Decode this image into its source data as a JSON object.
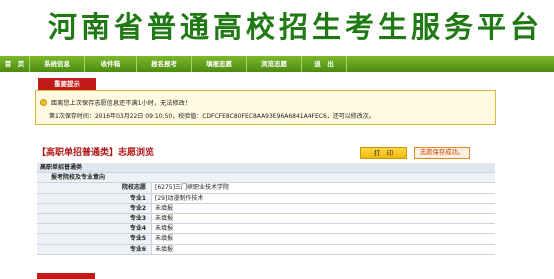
{
  "banner": {
    "title": "河南省普通高校招生考生服务平台"
  },
  "nav": {
    "items": [
      {
        "label": "首　页",
        "width": 30
      },
      {
        "label": "系统信息",
        "width": 55
      },
      {
        "label": "收件箱",
        "width": 52
      },
      {
        "label": "报名报考",
        "width": 55
      },
      {
        "label": "填报志愿",
        "width": 55
      },
      {
        "label": "浏览志愿",
        "width": 55
      },
      {
        "label": "退　出",
        "width": 45
      }
    ]
  },
  "notice": {
    "tab_label": "重要提示",
    "line1": "距离您上次保存志愿信息还不满1小时，无法修改！",
    "line2": "第1次保存时间：2016年03月22日 09:10:50，校验值：CDFCFE8C80FEC8AA93E96A6841A4FEC6，还可以修改次。"
  },
  "page_heading": "【高职单招普通类】志愿浏览",
  "print_label": "打　印",
  "saved_label": "志愿保存成功。",
  "table": {
    "header1": "高职单招普通类",
    "header2": "报考院校及专业意向",
    "rows": [
      {
        "label": "院校志愿",
        "value": "[6275]三门峡职业技术学院"
      },
      {
        "label": "专业1",
        "value": "[29]动漫制作技术"
      },
      {
        "label": "专业2",
        "value": "未填报"
      },
      {
        "label": "专业3",
        "value": "未填报"
      },
      {
        "label": "专业4",
        "value": "未填报"
      },
      {
        "label": "专业5",
        "value": "未填报"
      },
      {
        "label": "专业6",
        "value": "未填报"
      }
    ]
  }
}
